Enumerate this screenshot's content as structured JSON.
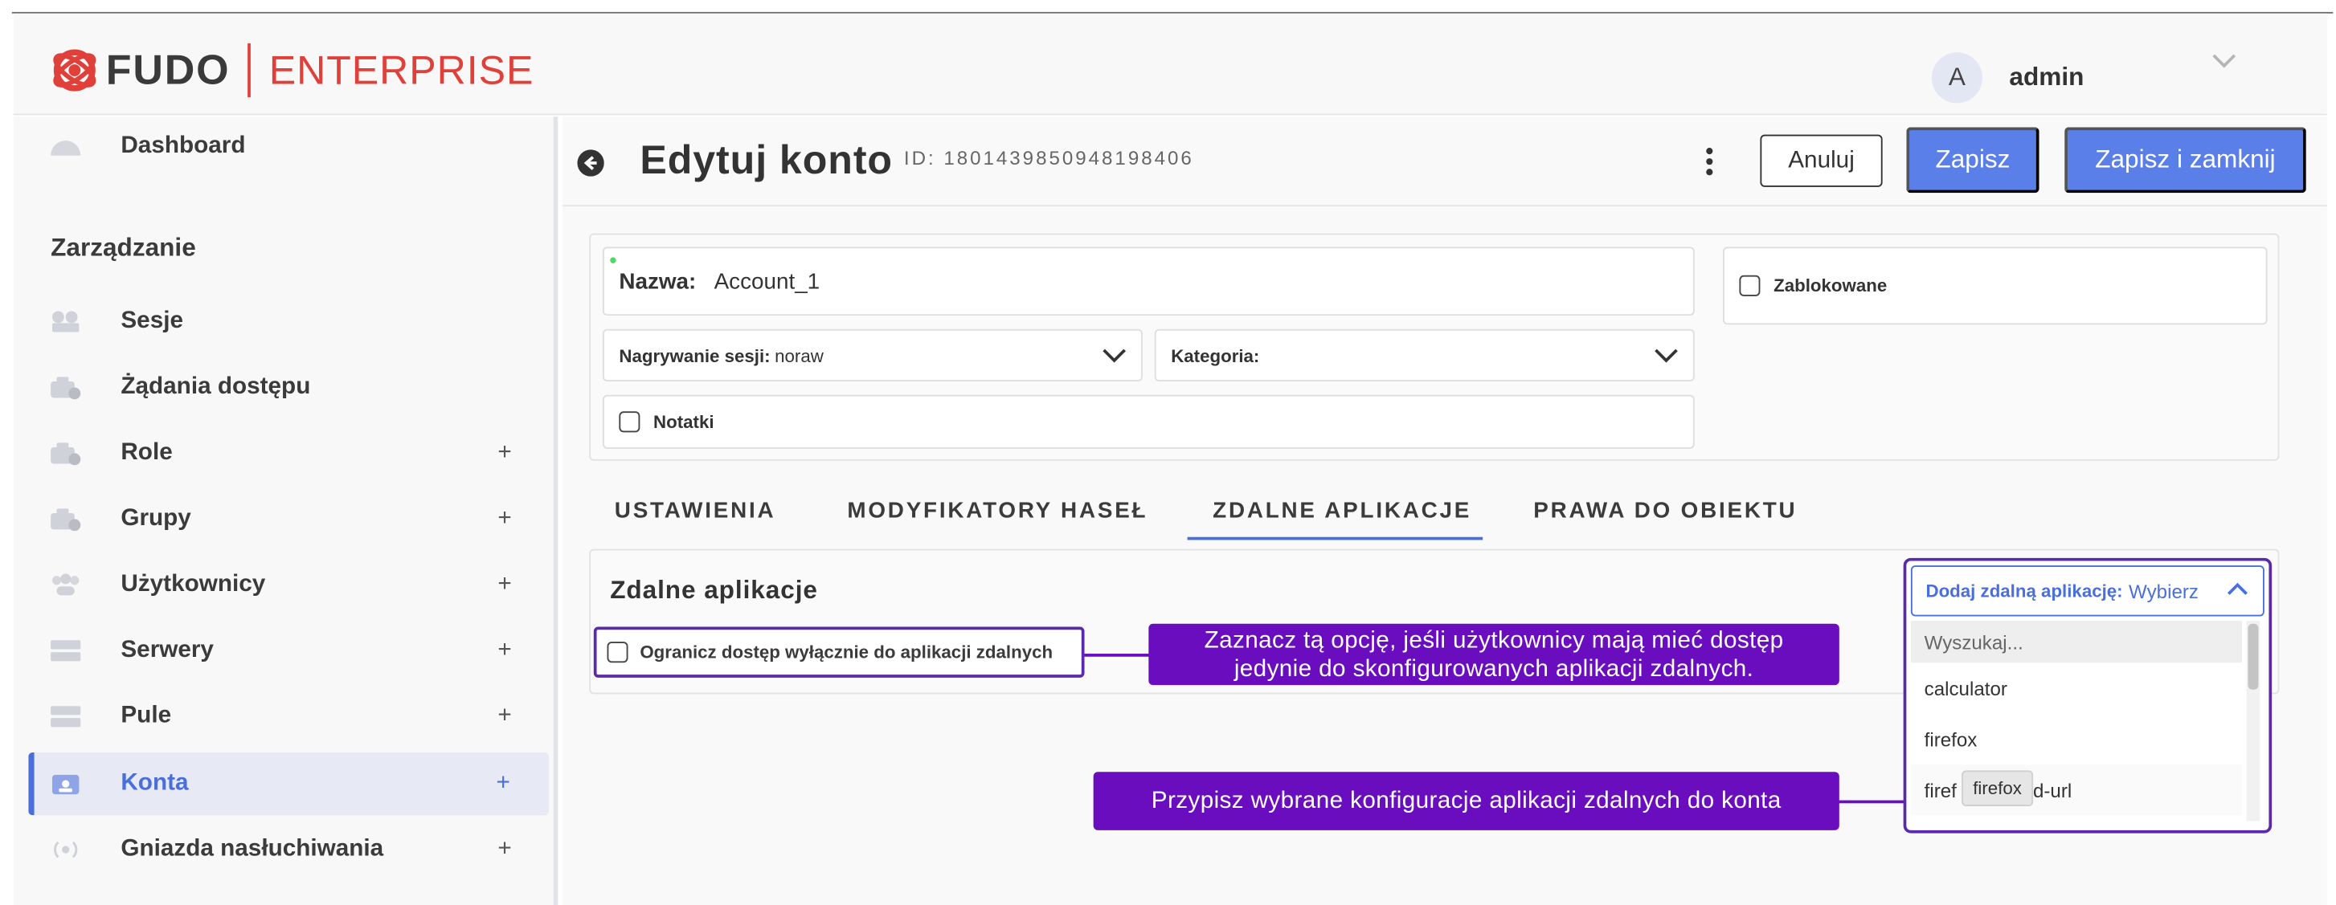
{
  "header": {
    "brand": "FUDO",
    "brand_suffix": "ENTERPRISE",
    "user_initial": "A",
    "user_name": "admin",
    "brand_colors": {
      "accent": "#4a6fdc",
      "brand_red": "#e0403a",
      "annotation": "#6a0dbf"
    }
  },
  "sidebar": {
    "top_item": {
      "label": "Dashboard",
      "icon": "dashboard-icon"
    },
    "section_title": "Zarządzanie",
    "items": [
      {
        "label": "Sesje",
        "icon": "camera-icon",
        "plus": ""
      },
      {
        "label": "Żądania dostępu",
        "icon": "access-request-icon",
        "plus": ""
      },
      {
        "label": "Role",
        "icon": "roles-icon",
        "plus": "+"
      },
      {
        "label": "Grupy",
        "icon": "groups-icon",
        "plus": "+"
      },
      {
        "label": "Użytkownicy",
        "icon": "users-icon",
        "plus": "+"
      },
      {
        "label": "Serwery",
        "icon": "server-icon",
        "plus": "+"
      },
      {
        "label": "Pule",
        "icon": "pool-icon",
        "plus": "+"
      },
      {
        "label": "Konta",
        "icon": "account-icon",
        "plus": "+",
        "active": true
      },
      {
        "label": "Gniazda nasłuchiwania",
        "icon": "listener-icon",
        "plus": "+"
      }
    ]
  },
  "toolbar": {
    "title": "Edytuj konto",
    "record_id": "ID: 1801439850948198406",
    "cancel_label": "Anuluj",
    "save_label": "Zapisz",
    "save_close_label": "Zapisz i zamknij"
  },
  "form": {
    "name_label": "Nazwa:",
    "name_value": "Account_1",
    "recording_label": "Nagrywanie sesji:",
    "recording_value": "noraw",
    "category_label": "Kategoria:",
    "category_value": "",
    "notes_label": "Notatki",
    "blocked_label": "Zablokowane"
  },
  "tabs": [
    {
      "label": "USTAWIENIA"
    },
    {
      "label": "MODYFIKATORY HASEŁ"
    },
    {
      "label": "ZDALNE APLIKACJE",
      "active": true
    },
    {
      "label": "PRAWA DO OBIEKTU"
    }
  ],
  "remote_apps": {
    "title": "Zdalne aplikacje",
    "restrict_label": "Ogranicz dostęp wyłącznie do aplikacji zdalnych",
    "add_key": "Dodaj zdalną aplikację:",
    "add_value": "Wybierz",
    "search_placeholder": "Wyszukaj...",
    "options": [
      "calculator",
      "firefox",
      "firefox-fixed-url"
    ],
    "option_visible_prefix": "firef",
    "option_visible_suffix": "ed-url",
    "tooltip": "firefox"
  },
  "annotations": {
    "restrict_note": "Zaznacz tą opcję, jeśli użytkownicy mają mieć dostęp jedynie do skonfigurowanych aplikacji zdalnych.",
    "restrict_note_line1": "Zaznacz tą opcję, jeśli użytkownicy mają mieć dostęp",
    "restrict_note_line2": "jedynie do skonfigurowanych aplikacji zdalnych.",
    "assign_note": "Przypisz wybrane konfiguracje aplikacji zdalnych do konta"
  }
}
